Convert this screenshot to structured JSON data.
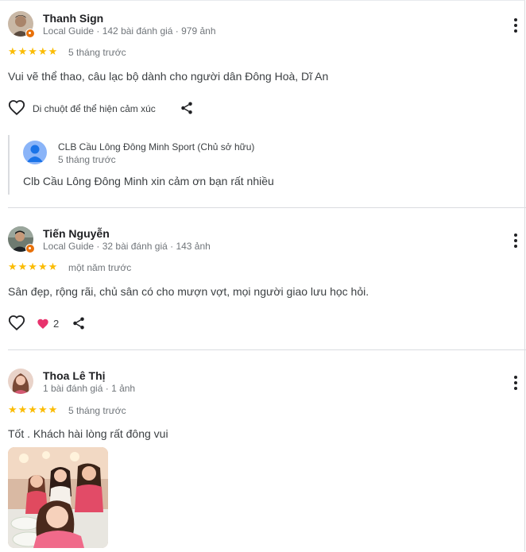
{
  "reviews": [
    {
      "name": "Thanh Sign",
      "meta": "Local Guide · 142 bài đánh giá · 979 ảnh",
      "rating": 5,
      "stars": "★★★★★",
      "when": "5 tháng trước",
      "text": "Vui vẽ thể thao, câu lạc bộ dành cho người dân Đông Hoà, Dĩ An",
      "react_hint": "Di chuột để thể hiện cảm xúc",
      "owner": {
        "name": "CLB Cầu Lông Đông Minh Sport (Chủ sở hữu)",
        "when": "5 tháng trước",
        "text": "Clb Cầu Lông Đông Minh xin cảm ơn bạn rất nhiều"
      }
    },
    {
      "name": "Tiến Nguyễn",
      "meta": "Local Guide · 32 bài đánh giá · 143 ảnh",
      "rating": 5,
      "stars": "★★★★★",
      "when": "một năm trước",
      "text": "Sân đẹp, rộng rãi, chủ sân có cho mượn vợt, mọi người giao lưu học hỏi.",
      "like_count": "2"
    },
    {
      "name": "Thoa Lê Thị",
      "meta": "1 bài đánh giá · 1 ảnh",
      "rating": 5,
      "stars": "★★★★★",
      "when": "5 tháng trước",
      "text": "Tốt . Khách hài lòng rất đông vui"
    }
  ],
  "colors": {
    "star": "#fbbc04",
    "local_guide_badge": "#e8710a",
    "owner_avatar": "#8ab4f8",
    "heart_reaction": "#e8336d"
  },
  "icons": [
    "heart-outline-icon",
    "share-icon",
    "more-vert-icon",
    "heart-filled-icon",
    "person-icon"
  ]
}
